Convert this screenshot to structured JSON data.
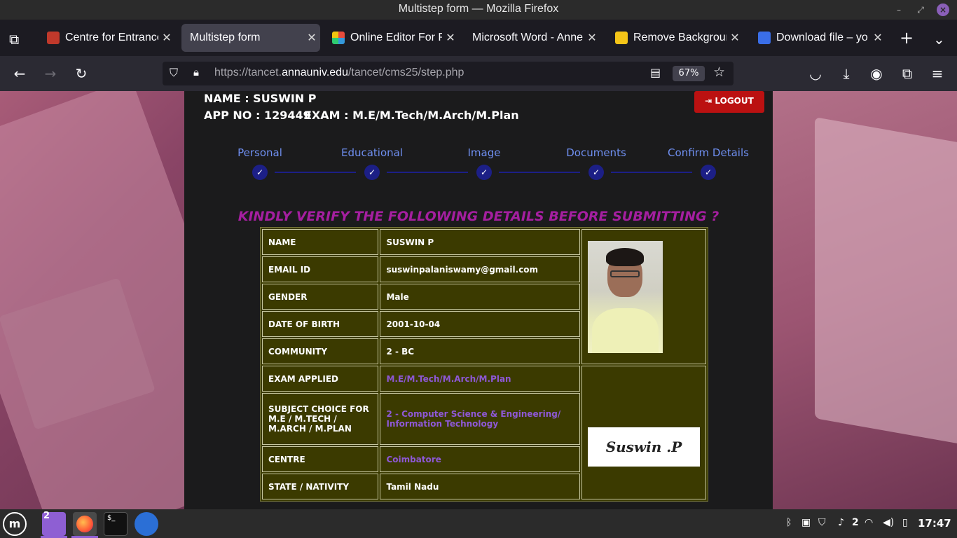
{
  "window": {
    "title": "Multistep form — Mozilla Firefox"
  },
  "tabs": [
    {
      "label": "Centre for Entrance",
      "active": false
    },
    {
      "label": "Multistep form",
      "active": true
    },
    {
      "label": "Online Editor For P",
      "active": false
    },
    {
      "label": "Microsoft Word - Anne",
      "active": false
    },
    {
      "label": "Remove Background",
      "active": false
    },
    {
      "label": "Download file – yo",
      "active": false
    }
  ],
  "navbar": {
    "url_prefix": "https://tancet.",
    "url_host": "annauniv.edu",
    "url_path": "/tancet/cms25/step.php",
    "zoom": "67%"
  },
  "page": {
    "name_line": "NAME : SUSWIN P",
    "app_no_line": "APP NO : 129449",
    "exam_line": "EXAM : M.E/M.Tech/M.Arch/M.Plan",
    "logout_label": "LOGOUT",
    "steps": [
      "Personal",
      "Educational",
      "Image",
      "Documents",
      "Confirm Details"
    ],
    "verify_heading": "KINDLY VERIFY THE FOLLOWING DETAILS BEFORE SUBMITTING ?",
    "details": [
      {
        "label": "NAME",
        "value": "SUSWIN P"
      },
      {
        "label": "EMAIL ID",
        "value": "suswinpalaniswamy@gmail.com"
      },
      {
        "label": "GENDER",
        "value": "Male"
      },
      {
        "label": "DATE OF BIRTH",
        "value": "2001-10-04"
      },
      {
        "label": "COMMUNITY",
        "value": "2 - BC"
      },
      {
        "label": "EXAM APPLIED",
        "value": "M.E/M.Tech/M.Arch/M.Plan"
      },
      {
        "label": "SUBJECT CHOICE FOR M.E / M.TECH / M.ARCH / M.PLAN",
        "value": "2 - Computer Science & Engineering/ Information Technology"
      },
      {
        "label": "CENTRE",
        "value": "Coimbatore"
      },
      {
        "label": "STATE / NATIVITY",
        "value": "Tamil Nadu"
      }
    ],
    "signature_text": "Suswin .P"
  },
  "taskbar": {
    "files_badge": "2",
    "notifications_count": "2",
    "clock": "17:47"
  },
  "colors": {
    "step_blue": "#1c1f86",
    "heading_purple": "#a51fa0",
    "table_bg": "#3b3a00",
    "logout_red": "#bb1111"
  }
}
